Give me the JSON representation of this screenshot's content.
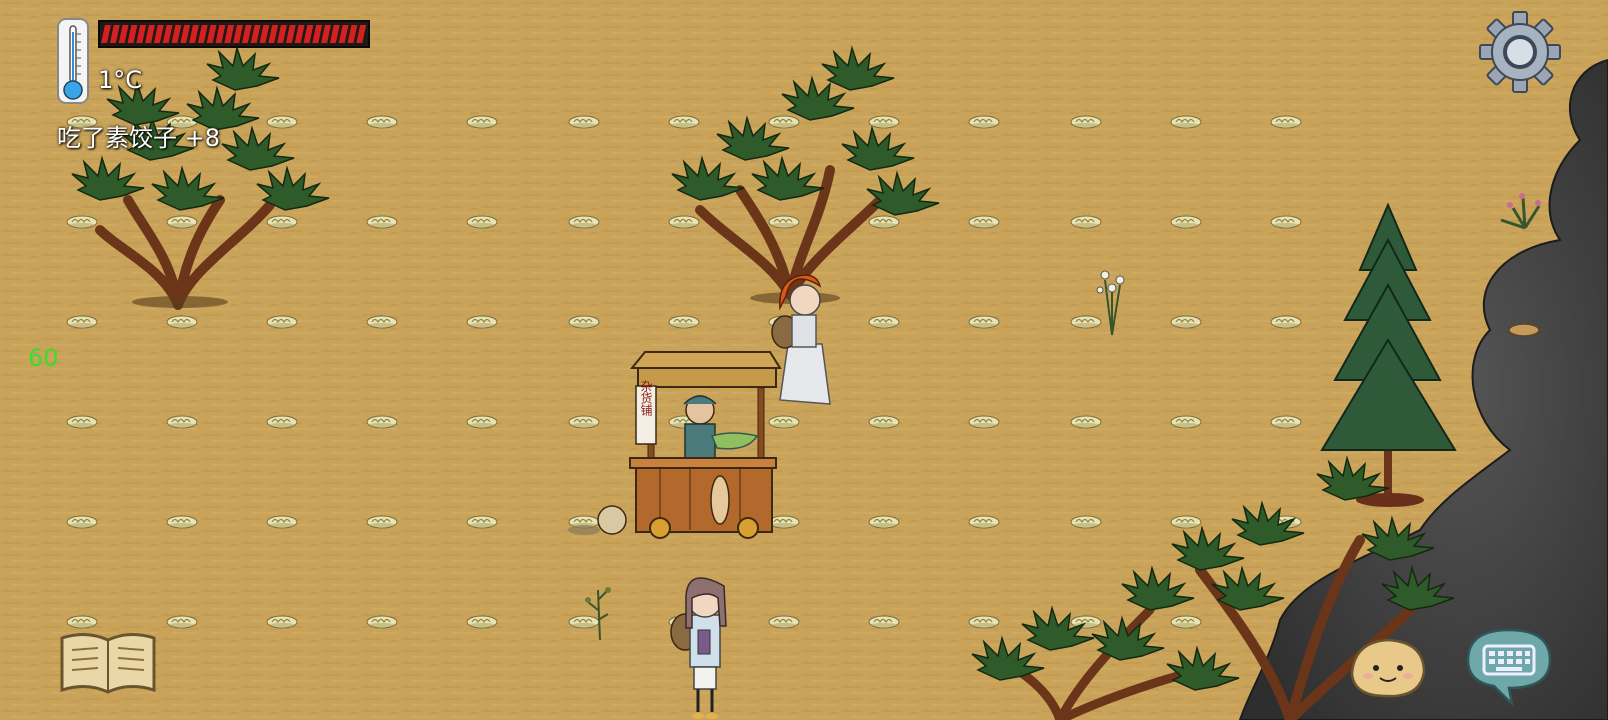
{
  "hud": {
    "temperature": "1°C",
    "hunger_level": 1.0,
    "message": "吃了素饺子 +8",
    "fps": "60"
  },
  "stall": {
    "sign_text": "杂货铺"
  },
  "icons": {
    "thermometer": "thermometer-icon",
    "settings": "gear-icon",
    "recipe_book": "book-icon",
    "emote": "potato-face-icon",
    "chat": "keyboard-icon"
  },
  "colors": {
    "ground": "#c9a35a",
    "hunger_red": "#d42020",
    "fps_green": "#3cdc2a",
    "rock_dark": "#3c3c3c"
  }
}
